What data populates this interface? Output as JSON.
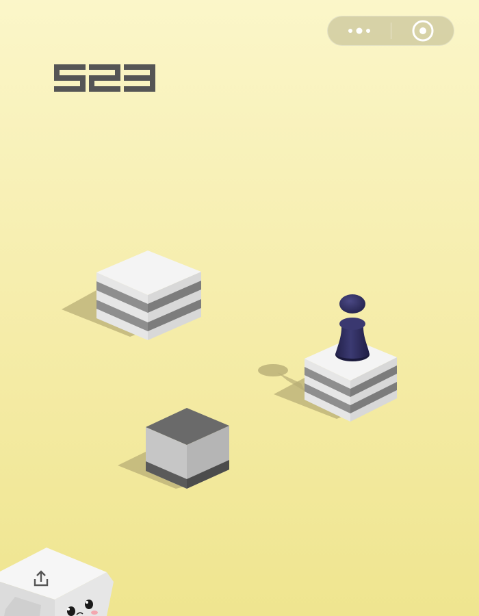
{
  "game": {
    "score": "523"
  },
  "top_bar": {
    "more_icon": "more-dots-icon",
    "close_icon": "target-circle-icon"
  },
  "bottom_left": {
    "share_icon": "share-upload-icon",
    "character": "white-cube-panda-face"
  },
  "colors": {
    "background_top": "#fbf6c9",
    "background_bottom": "#efe58f",
    "score": "#555555",
    "pawn": "#2e2c57",
    "block_top": "#f5f5f5",
    "block_stripe": "#8a8a8a",
    "dark_block_top": "#686868",
    "shadow": "#b0a870"
  }
}
